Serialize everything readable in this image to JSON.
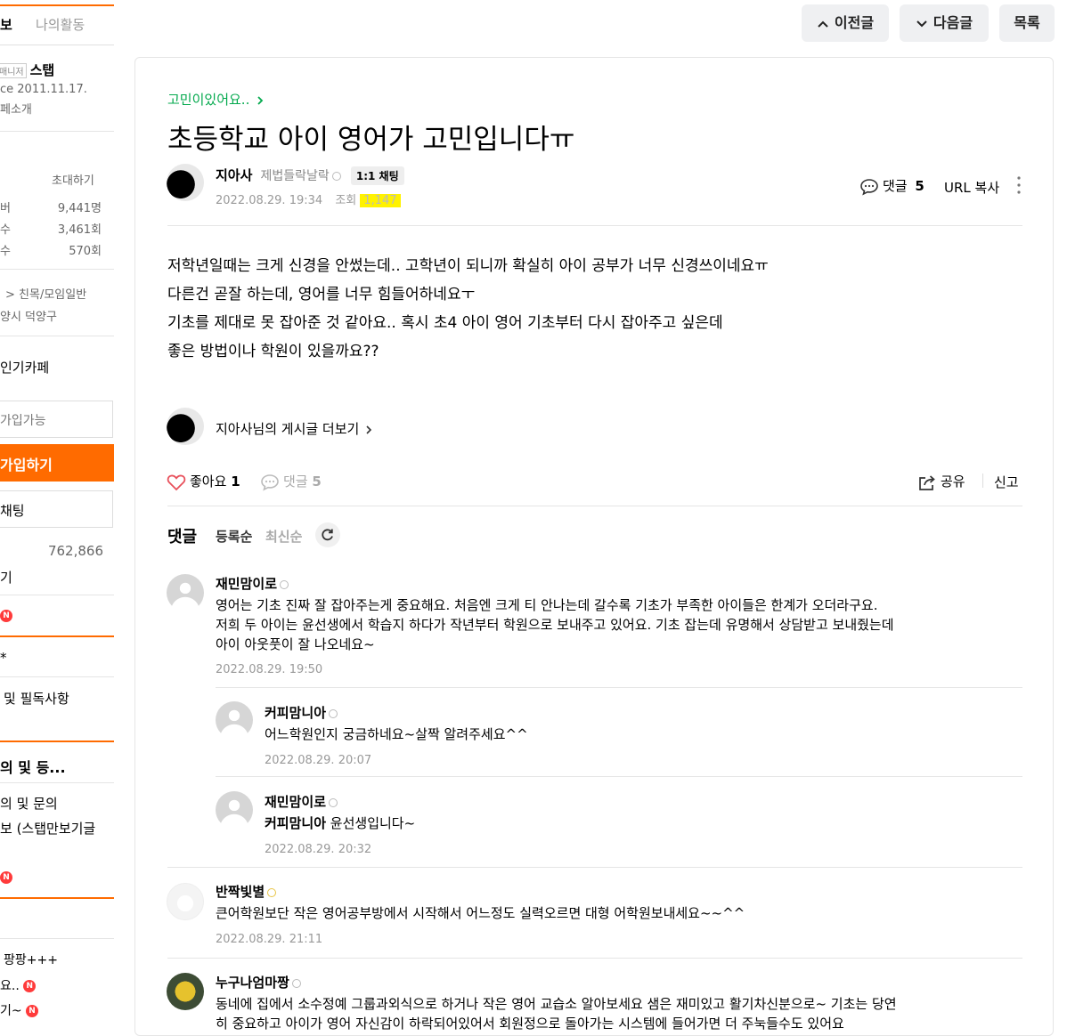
{
  "sidebar": {
    "tab_info": "보",
    "tab_activity": "나의활동",
    "manager_tag": "매니저",
    "manager_name": "스탭",
    "since": "ce 2011.11.17.",
    "intro_link": "페소개",
    "invite": "초대하기",
    "stats": [
      {
        "label": "버",
        "value": "9,441명"
      },
      {
        "label": "수",
        "value": "3,461회"
      },
      {
        "label": "수",
        "value": "570회"
      }
    ],
    "category": "> 친목/모임일반",
    "region": "양시 덕양구",
    "popular": "인기카페",
    "join_status": "가입가능",
    "join_button": "가입하기",
    "chat_button": "채팅",
    "count_value": "762,866",
    "item_gi": "기",
    "item_star": "*",
    "notice": "및 필독사항",
    "section_title": "의 및 등...",
    "sub1": "의 및 문의",
    "sub2": "보 (스탭만보기글",
    "item_pang": "팡팡+++",
    "item_yo": "요..",
    "item_gi2": "기~",
    "badge": "N"
  },
  "topnav": {
    "prev": "이전글",
    "next": "다음글",
    "list": "목록"
  },
  "post": {
    "menu": "고민이있어요..",
    "title": "초등학교 아이 영어가 고민입니다ㅠ",
    "author": "지아사",
    "author_status": "제법들락날락",
    "chat_badge": "1:1 채팅",
    "date": "2022.08.29. 19:34",
    "view_label": "조회",
    "view_count": "1,147",
    "comments_label": "댓글",
    "comments_count": "5",
    "url_copy": "URL 복사",
    "body": [
      "저학년일때는 크게 신경을 안썼는데.. 고학년이 되니까 확실히 아이 공부가 너무 신경쓰이네요ㅠ",
      "다른건 곧잘 하는데, 영어를 너무 힘들어하네요ㅜ",
      "기초를 제대로 못 잡아준 것 같아요.. 혹시 초4 아이 영어 기초부터 다시 잡아주고 싶은데",
      "좋은 방법이나 학원이 있을까요??"
    ],
    "more_posts": "지아사님의 게시글 더보기",
    "like_label": "좋아요",
    "like_count": "1",
    "comment_label": "댓글",
    "comment_count": "5",
    "share": "공유",
    "report": "신고"
  },
  "comments_section": {
    "title": "댓글",
    "sort_register": "등록순",
    "sort_latest": "최신순",
    "items": [
      {
        "name": "재민맘이로",
        "lines": [
          "영어는 기초 진짜 잘 잡아주는게 중요해요. 처음엔 크게 티 안나는데 갈수록 기초가 부족한 아이들은 한계가 오더라구요.",
          "저희 두 아이는 윤선생에서 학습지 하다가 작년부터 학원으로 보내주고 있어요. 기초 잡는데 유명해서 상담받고 보내줬는데",
          "아이 아웃풋이 잘 나오네요~"
        ],
        "date": "2022.08.29. 19:50"
      },
      {
        "name": "커피맘니아",
        "lines": [
          "어느학원인지 궁금하네요~살짝 알려주세요^^"
        ],
        "date": "2022.08.29. 20:07"
      },
      {
        "name": "재민맘이로",
        "mention": "커피맘니아",
        "lines": [
          "윤선생입니다~"
        ],
        "date": "2022.08.29. 20:32"
      },
      {
        "name": "반짝빛별",
        "lines": [
          "큰어학원보단 작은 영어공부방에서 시작해서 어느정도 실력오르면 대형 어학원보내세요~~^^"
        ],
        "date": "2022.08.29. 21:11"
      },
      {
        "name": "누구나엄마짱",
        "lines": [
          "동네에 집에서 소수정예 그룹과외식으로 하거나 작은 영어 교습소 알아보세요 샘은 재미있고 활기차신분으로~ 기초는 당연",
          "히 중요하고 아이가 영어 자신감이 하락되어있어서 회원정으로 돌아가는 시스템에 들어가면 더 주눅들수도 있어요"
        ]
      }
    ]
  }
}
